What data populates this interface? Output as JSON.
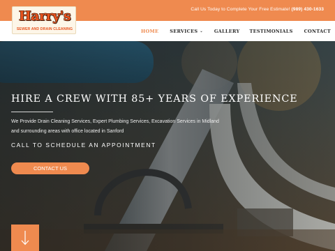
{
  "topbar": {
    "call_text": "Call Us Today to Complete Your Free Estimate!",
    "phone": "(989) 430-1633"
  },
  "logo": {
    "name": "Harry's",
    "tagline": "Sewer and Drain Cleaning"
  },
  "nav": {
    "items": [
      {
        "label": "HOME",
        "active": true
      },
      {
        "label": "SERVICES",
        "has_dropdown": true
      },
      {
        "label": "GALLERY"
      },
      {
        "label": "TESTIMONIALS"
      },
      {
        "label": "CONTACT"
      }
    ]
  },
  "hero": {
    "headline": "HIRE A CREW WITH 85+ YEARS OF EXPERIENCE",
    "description": "We Provide Drain Cleaning Services, Expert Plumbing Services, Excavation Services in Midland and surrounding areas with office located in Sanford",
    "cta_text": "CALL TO SCHEDULE AN APPOINTMENT",
    "button_label": "CONTACT US",
    "scroll_icon": "arrow-down-icon"
  },
  "colors": {
    "accent": "#ef8a4f",
    "logo_red": "#e8531e",
    "nav_text": "#2b2b2b"
  }
}
